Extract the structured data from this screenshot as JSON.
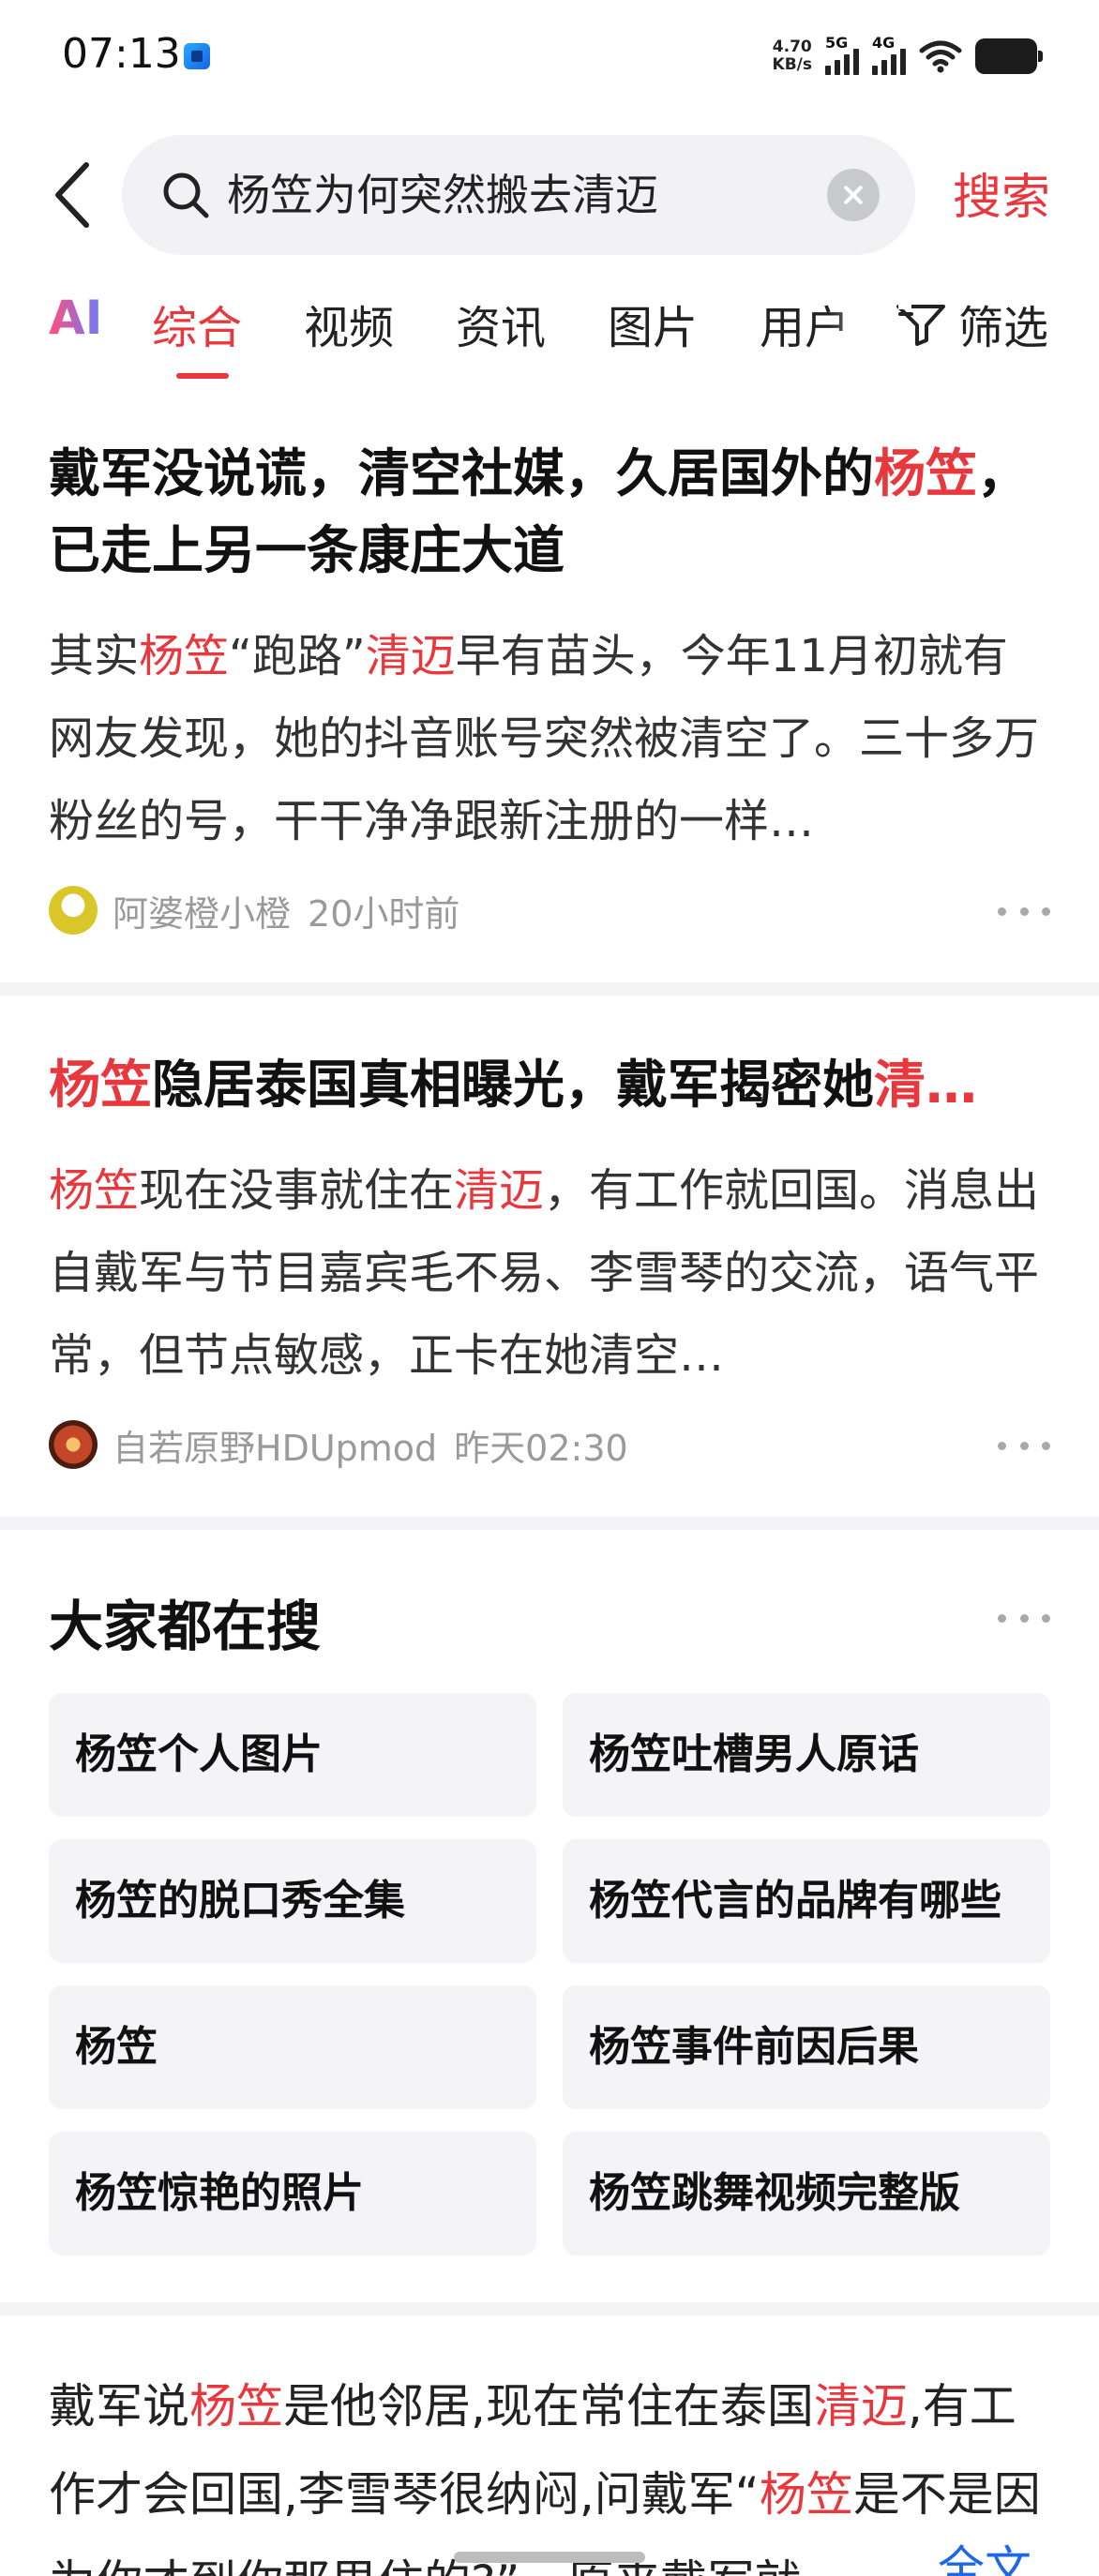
{
  "status_bar": {
    "time": "07:13",
    "net_speed_value": "4.70",
    "net_speed_unit": "KB/s",
    "signal1_label": "5G",
    "signal2_label": "4G",
    "icons": [
      "app-icon",
      "signal-icon",
      "wifi-icon",
      "battery-icon"
    ]
  },
  "search": {
    "query": "杨笠为何突然搬去清迈",
    "button_label": "搜索"
  },
  "tabs": {
    "items": [
      "AI",
      "综合",
      "视频",
      "资讯",
      "图片",
      "用户"
    ],
    "active": "综合",
    "filter_label": "筛选"
  },
  "results": [
    {
      "title_parts": [
        "戴军没说谎，清空社媒，久居国外的",
        "杨笠",
        "，已走上另一条康庄大道"
      ],
      "body_parts": [
        "其实",
        "杨笠",
        "“跑路”",
        "清迈",
        "早有苗头，今年11月初就有网友发现，她的抖音账号突然被清空了。三十多万粉丝的号，干干净净跟新注册的一样…"
      ],
      "author": "阿婆橙小橙",
      "time": "20小时前"
    },
    {
      "title_parts": [
        "杨笠",
        "隐居泰国真相曝光，戴军揭密她",
        "清…"
      ],
      "body_parts": [
        "杨笠",
        "现在没事就住在",
        "清迈",
        "，有工作就回国。消息出自戴军与节目嘉宾毛不易、李雪琴的交流，语气平常，但节点敏感，正卡在她清空…"
      ],
      "author": "自若原野HDUpmod",
      "time": "昨天02:30"
    }
  ],
  "suggestions": {
    "title": "大家都在搜",
    "items": [
      "杨笠个人图片",
      "杨笠吐槽男人原话",
      "杨笠的脱口秀全集",
      "杨笠代言的品牌有哪些",
      "杨笠",
      "杨笠事件前因后果",
      "杨笠惊艳的照片",
      "杨笠跳舞视频完整版"
    ]
  },
  "bottom_result": {
    "body_parts": [
      "戴军说",
      "杨笠",
      "是他邻居,现在常住在泰国",
      "清迈",
      ",有工作才会回国,李雪琴很纳闷,问戴军“",
      "杨笠",
      "是不是因为你才到你那里住的?”…原来戴军就"
    ],
    "full_text_label": "全文"
  },
  "colors": {
    "highlight": "#e8383d",
    "link": "#1f66e6"
  }
}
